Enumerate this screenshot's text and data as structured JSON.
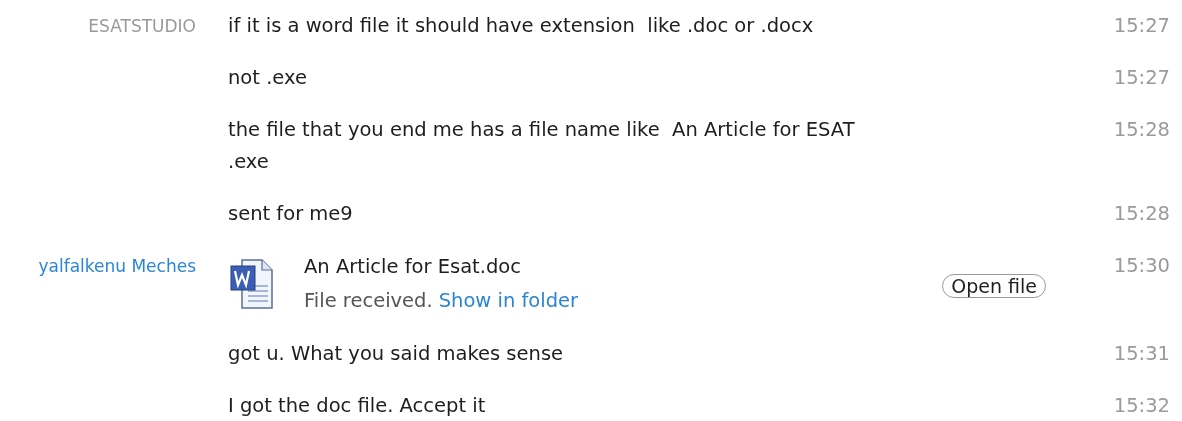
{
  "messages": [
    {
      "sender": "ESATSTUDIO",
      "color": "#9a9a9a",
      "kind": "text",
      "text": "if it is a word file it should have extension  like .doc or .docx",
      "time": "15:27"
    },
    {
      "kind": "text",
      "text": "not .exe",
      "time": "15:27"
    },
    {
      "kind": "text",
      "text": "the file that you end me has a file name like  An Article for ESAT .exe",
      "time": "15:28"
    },
    {
      "kind": "text",
      "text": "sent for me9",
      "time": "15:28"
    },
    {
      "sender": "yalfalkenu Meches",
      "color": "#2a86d4",
      "kind": "file",
      "file_name": "An Article for Esat.doc",
      "status": "File received.",
      "link": "Show in folder",
      "button": "Open file",
      "time": "15:30"
    },
    {
      "kind": "text",
      "text": "got u. What you said makes sense",
      "time": "15:31"
    },
    {
      "kind": "text",
      "text": "I got the doc file. Accept it",
      "time": "15:32"
    }
  ]
}
